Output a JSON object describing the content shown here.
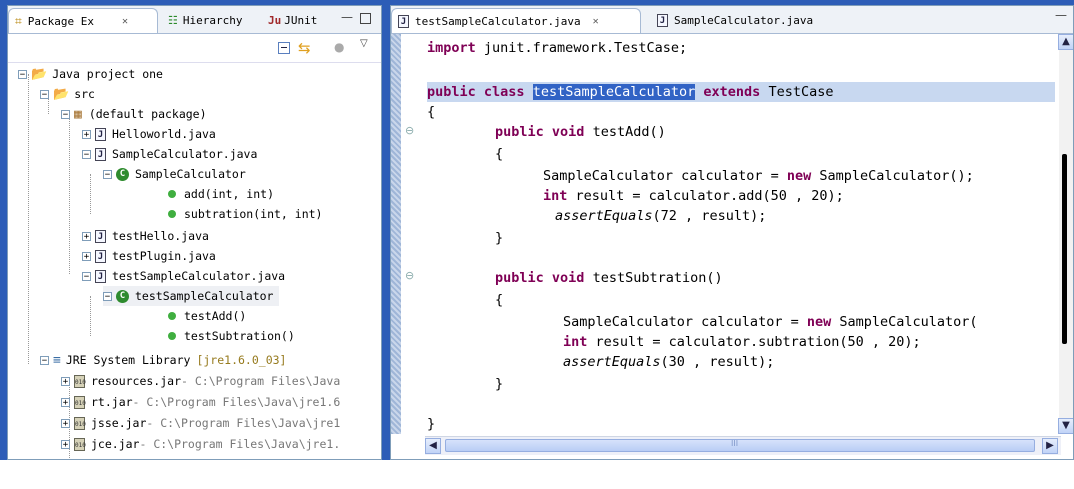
{
  "left_panel": {
    "tabs": [
      {
        "label": "Package Ex",
        "close": "✕"
      },
      {
        "label": "Hierarchy"
      },
      {
        "label": "JUnit"
      }
    ],
    "tree": [
      {
        "label": "Java project one"
      },
      {
        "label": "src"
      },
      {
        "label": "(default package)"
      },
      {
        "label": "Helloworld.java"
      },
      {
        "label": "SampleCalculator.java"
      },
      {
        "label": "SampleCalculator"
      },
      {
        "label": "add(int, int)"
      },
      {
        "label": "subtration(int, int)"
      },
      {
        "label": "testHello.java"
      },
      {
        "label": "testPlugin.java"
      },
      {
        "label": "testSampleCalculator.java"
      },
      {
        "label": "testSampleCalculator"
      },
      {
        "label": "testAdd()"
      },
      {
        "label": "testSubtration()"
      },
      {
        "label": "JRE System Library",
        "suffix": "[jre1.6.0_03]"
      },
      {
        "label": "resources.jar",
        "path": " - C:\\Program Files\\Java"
      },
      {
        "label": "rt.jar",
        "path": " - C:\\Program Files\\Java\\jre1.6"
      },
      {
        "label": "jsse.jar",
        "path": " - C:\\Program Files\\Java\\jre1"
      },
      {
        "label": "jce.jar",
        "path": " - C:\\Program Files\\Java\\jre1."
      }
    ]
  },
  "editor": {
    "tabs": [
      {
        "label": "testSampleCalculator.java",
        "close": "✕"
      },
      {
        "label": "SampleCalculator.java"
      }
    ],
    "lines": {
      "l1": {
        "kw": "import",
        "rest": " junit.framework.TestCase;"
      },
      "l3": {
        "kw1": "public",
        "kw2": "class",
        "sel": "testSampleCalculator",
        "kw3": "extends",
        "rest": " TestCase"
      },
      "l4": "{",
      "l5": {
        "kw1": "public",
        "kw2": "void",
        "rest": " testAdd()"
      },
      "l6": "{",
      "l7": {
        "pre": "SampleCalculator calculator = ",
        "kw": "new",
        "rest": " SampleCalculator();"
      },
      "l8": {
        "kw": "int",
        "rest": " result = calculator.add(50 , 20);"
      },
      "l9": {
        "it": "assertEquals",
        "rest": "(72 , result);"
      },
      "l10": "}",
      "l12": {
        "kw1": "public",
        "kw2": "void",
        "rest": " testSubtration()"
      },
      "l13": "{",
      "l14": {
        "pre": "SampleCalculator calculator = ",
        "kw": "new",
        "rest": " SampleCalculator("
      },
      "l15": {
        "kw": "int",
        "rest": " result = calculator.subtration(50 , 20);"
      },
      "l16": {
        "it": "assertEquals",
        "rest": "(30 , result);"
      },
      "l17": "}",
      "l20": "}"
    },
    "scroll_mark": "III"
  }
}
